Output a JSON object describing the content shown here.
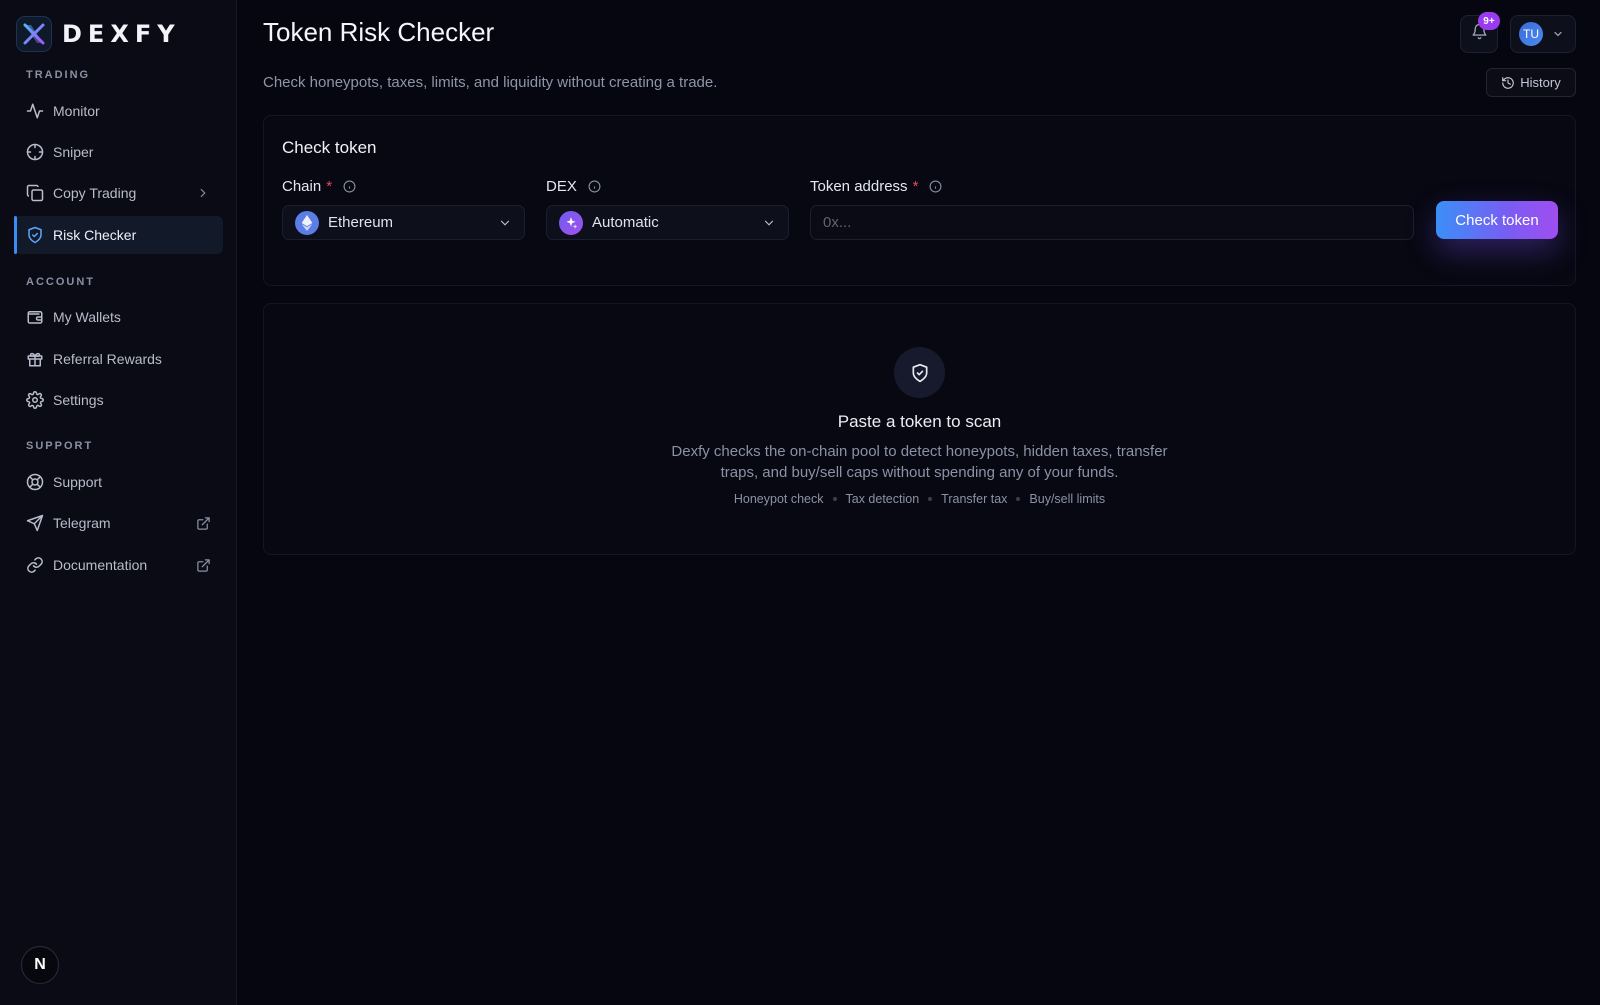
{
  "brand": {
    "name": "DEXFY"
  },
  "sidebar": {
    "sections": {
      "trading": "TRADING",
      "account": "ACCOUNT",
      "support": "SUPPORT"
    },
    "items": [
      {
        "label": "Monitor",
        "icon": "activity-icon"
      },
      {
        "label": "Sniper",
        "icon": "crosshair-icon"
      },
      {
        "label": "Copy Trading",
        "icon": "copy-icon"
      },
      {
        "label": "Risk Checker",
        "icon": "shield-check-icon",
        "active": true
      },
      {
        "label": "My Wallets",
        "icon": "wallet-icon"
      },
      {
        "label": "Referral Rewards",
        "icon": "gift-icon"
      },
      {
        "label": "Settings",
        "icon": "gear-icon"
      },
      {
        "label": "Support",
        "icon": "lifebuoy-icon"
      },
      {
        "label": "Telegram",
        "icon": "send-icon"
      },
      {
        "label": "Documentation",
        "icon": "link-icon"
      }
    ],
    "footer_badge": "N"
  },
  "header": {
    "title": "Token Risk Checker",
    "subtitle": "Check honeypots, taxes, limits, and liquidity without creating a trade.",
    "notification_count": "9+",
    "user_initials": "TU",
    "history_label": "History"
  },
  "form": {
    "title": "Check token",
    "chain_label": "Chain",
    "chain_value": "Ethereum",
    "dex_label": "DEX",
    "dex_value": "Automatic",
    "address_label": "Token address",
    "required_mark": "*",
    "address_placeholder": "0x...",
    "submit_label": "Check token"
  },
  "empty_state": {
    "title": "Paste a token to scan",
    "description": "Dexfy checks the on-chain pool to detect honeypots, hidden taxes, transfer traps, and buy/sell caps without spending any of your funds.",
    "tags": [
      "Honeypot check",
      "Tax detection",
      "Transfer tax",
      "Buy/sell limits"
    ]
  },
  "colors": {
    "background": "#05060f",
    "sidebar": "#0a0b14",
    "accent_blue": "#3b8ff7",
    "accent_purple": "#a04ef0",
    "required": "#e84a5f"
  }
}
